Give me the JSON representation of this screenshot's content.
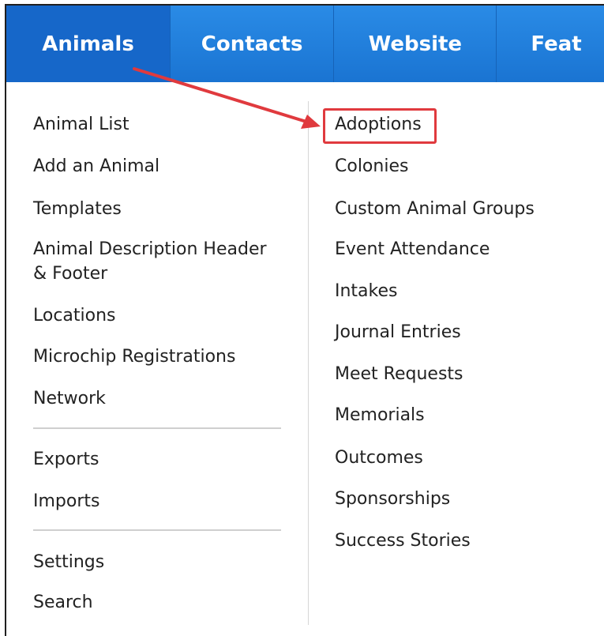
{
  "nav": {
    "tabs": [
      {
        "label": "Animals"
      },
      {
        "label": "Contacts"
      },
      {
        "label": "Website"
      },
      {
        "label": "Feat"
      }
    ]
  },
  "menu": {
    "left": [
      {
        "label": "Animal List"
      },
      {
        "label": "Add an Animal"
      },
      {
        "label": "Templates"
      },
      {
        "label": "Animal Description Header"
      },
      {
        "label": "& Footer"
      },
      {
        "label": "Locations"
      },
      {
        "label": "Microchip Registrations"
      },
      {
        "label": "Network"
      },
      {
        "label": "Exports"
      },
      {
        "label": "Imports"
      },
      {
        "label": "Settings"
      },
      {
        "label": "Search"
      }
    ],
    "right": [
      {
        "label": "Adoptions"
      },
      {
        "label": "Colonies"
      },
      {
        "label": "Custom Animal Groups"
      },
      {
        "label": "Event Attendance"
      },
      {
        "label": "Intakes"
      },
      {
        "label": "Journal Entries"
      },
      {
        "label": "Meet Requests"
      },
      {
        "label": "Memorials"
      },
      {
        "label": "Outcomes"
      },
      {
        "label": "Sponsorships"
      },
      {
        "label": "Success Stories"
      }
    ]
  },
  "colors": {
    "nav_blue": "#1a74d2",
    "annotation_red": "#e03a3e"
  }
}
